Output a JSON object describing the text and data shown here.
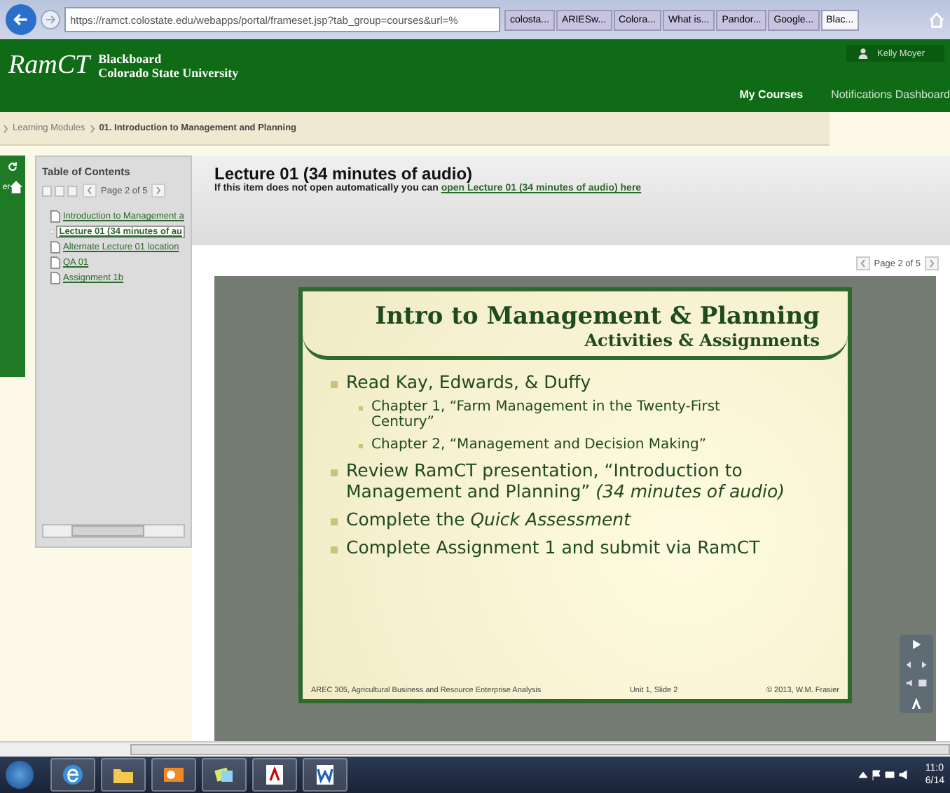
{
  "browser": {
    "url": "https://ramct.colostate.edu/webapps/portal/frameset.jsp?tab_group=courses&url=%",
    "tabs": [
      {
        "label": "colosta...",
        "selected": false
      },
      {
        "label": "ARIESw...",
        "selected": false
      },
      {
        "label": "Colora...",
        "selected": false
      },
      {
        "label": "What is...",
        "selected": false
      },
      {
        "label": "Pandor...",
        "selected": false
      },
      {
        "label": "Google...",
        "selected": false
      },
      {
        "label": "Blac...",
        "selected": true
      }
    ]
  },
  "header": {
    "logo": "RamCT",
    "brand_line_1": "Blackboard",
    "brand_line_2": "Colorado State University",
    "user": "Kelly Moyer",
    "nav": [
      {
        "label": "My Courses",
        "selected": true
      },
      {
        "label": "Notifications Dashboard",
        "selected": false
      }
    ]
  },
  "breadcrumb": [
    "Learning Modules",
    "01. Introduction to Management and Planning"
  ],
  "course_menu": {
    "label": "er"
  },
  "toc": {
    "title": "Table of Contents",
    "page": "Page 2 of 5",
    "items": [
      {
        "label": "Introduction to Management a",
        "selected": false
      },
      {
        "label": "Lecture 01 (34 minutes of au",
        "selected": true
      },
      {
        "label": "Alternate Lecture 01 location",
        "selected": false
      },
      {
        "label": "QA 01",
        "selected": false
      },
      {
        "label": "Assignment 1b",
        "selected": false
      }
    ]
  },
  "content": {
    "title": "Lecture 01 (34 minutes of audio)",
    "note": "If this item does not open automatically you can",
    "link": "open Lecture 01 (34 minutes of audio) here",
    "page": "Page 2 of 5"
  },
  "slide": {
    "title": "Intro to Management & Planning",
    "subtitle": "Activities & Assignments",
    "bullets": [
      {
        "kind": "main",
        "text": "Read Kay, Edwards, & Duffy"
      },
      {
        "kind": "sub",
        "text": "Chapter 1, “Farm Management in the Twenty-First Century”"
      },
      {
        "kind": "sub",
        "text": "Chapter 2, “Management and Decision Making”"
      },
      {
        "kind": "main",
        "text": "Review RamCT presentation, “Introduction to Management and Planning” *(34 minutes of audio)*"
      },
      {
        "kind": "main",
        "text": "Complete the *Quick Assessment*"
      },
      {
        "kind": "main",
        "text": "Complete Assignment 1 and submit via RamCT"
      }
    ],
    "footer_left": "AREC 305, Agricultural Business and Resource Enterprise Analysis",
    "footer_center": "Unit 1, Slide 2",
    "footer_right": "© 2013, W.M. Frasier"
  },
  "taskbar": {
    "time": "11:0",
    "date": "6/14"
  }
}
